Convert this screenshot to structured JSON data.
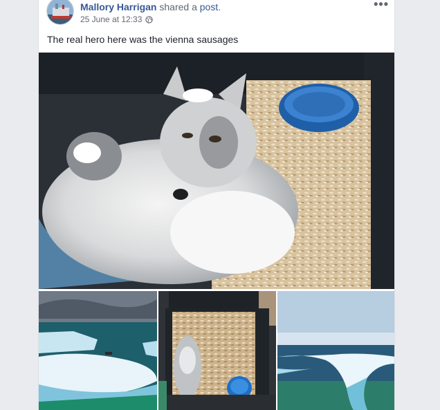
{
  "post": {
    "author": "Mallory Harrigan",
    "action_prefix": "shared a",
    "action_link": "post",
    "action_suffix": ".",
    "timestamp": "25 June at 12:33",
    "privacy_icon": "globe-icon",
    "more_icon": "more-options-icon",
    "text": "The real hero here was the vienna sausages"
  },
  "photos": {
    "main": "arctic-fox-in-crate-photo",
    "thumbnails": [
      "iceberg-photo",
      "crate-top-view-photo",
      "iceberg-arch-photo"
    ]
  },
  "colors": {
    "author_link": "#385898",
    "meta_text": "#616770",
    "card_bg": "#ffffff",
    "page_bg": "#e9ebee"
  }
}
